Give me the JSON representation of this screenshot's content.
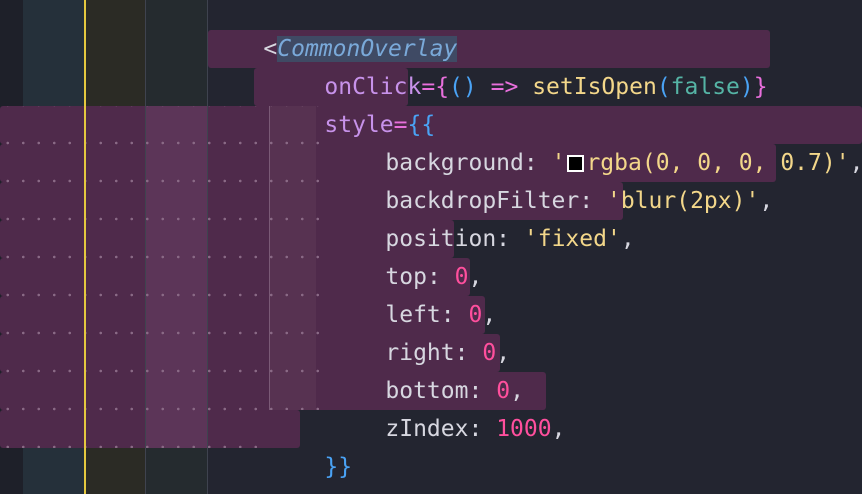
{
  "editor": {
    "theme_colors": {
      "background": "#232530",
      "selection": "#4f2a4b",
      "indent_guide_active": "#e5c83f"
    },
    "lines": [
      {
        "open_bracket": "<",
        "tag_name": "CommonOverlay"
      },
      {
        "attr": "onClick",
        "eq": "=",
        "open_brace": "{",
        "paren_open": "(",
        "paren_close": ")",
        "arrow": "=>",
        "func": "setIsOpen",
        "call_open": "(",
        "arg": "false",
        "call_close": ")",
        "close_brace": "}"
      },
      {
        "attr": "style",
        "eq": "=",
        "open_braces": "{{"
      },
      {
        "key": "background",
        "colon": ":",
        "quote_open": "'",
        "value": "rgba(0, 0, 0, 0.7)",
        "quote_close": "'",
        "comma": ","
      },
      {
        "key": "backdropFilter",
        "colon": ":",
        "value": "'blur(2px)'",
        "comma": ","
      },
      {
        "key": "position",
        "colon": ":",
        "value": "'fixed'",
        "comma": ","
      },
      {
        "key": "top",
        "colon": ":",
        "value": "0",
        "comma": ","
      },
      {
        "key": "left",
        "colon": ":",
        "value": "0",
        "comma": ","
      },
      {
        "key": "right",
        "colon": ":",
        "value": "0",
        "comma": ","
      },
      {
        "key": "bottom",
        "colon": ":",
        "value": "0",
        "comma": ","
      },
      {
        "key": "zIndex",
        "colon": ":",
        "value": "1000",
        "comma": ","
      },
      {
        "close_braces": "}}"
      },
      {
        "self_close": "/>"
      }
    ],
    "color_swatch": {
      "name": "color-swatch-icon",
      "color": "#000000"
    }
  }
}
